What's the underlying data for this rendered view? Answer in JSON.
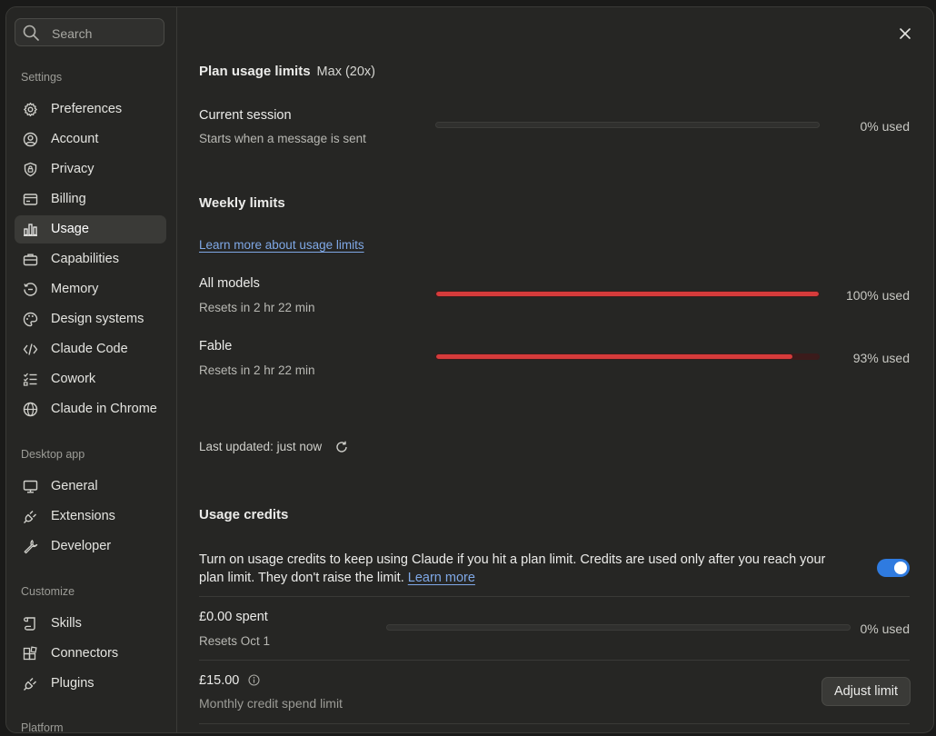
{
  "search": {
    "placeholder": "Search"
  },
  "sidebar": {
    "groups": [
      {
        "label": "Settings"
      },
      {
        "label": "Desktop app"
      },
      {
        "label": "Customize"
      },
      {
        "label": "Platform"
      }
    ],
    "items": [
      {
        "label": "Preferences",
        "icon": "gear-icon"
      },
      {
        "label": "Account",
        "icon": "user-circle-icon"
      },
      {
        "label": "Privacy",
        "icon": "shield-lock-icon"
      },
      {
        "label": "Billing",
        "icon": "credit-card-icon"
      },
      {
        "label": "Usage",
        "icon": "bar-chart-icon",
        "active": true
      },
      {
        "label": "Capabilities",
        "icon": "briefcase-icon"
      },
      {
        "label": "Memory",
        "icon": "history-icon"
      },
      {
        "label": "Design systems",
        "icon": "palette-icon"
      },
      {
        "label": "Claude Code",
        "icon": "code-icon"
      },
      {
        "label": "Cowork",
        "icon": "checklist-icon"
      },
      {
        "label": "Claude in Chrome",
        "icon": "globe-icon"
      },
      {
        "label": "General",
        "icon": "monitor-icon"
      },
      {
        "label": "Extensions",
        "icon": "plug-icon"
      },
      {
        "label": "Developer",
        "icon": "wrench-icon"
      },
      {
        "label": "Skills",
        "icon": "scroll-icon"
      },
      {
        "label": "Connectors",
        "icon": "blocks-icon"
      },
      {
        "label": "Plugins",
        "icon": "plug-icon"
      }
    ]
  },
  "plan": {
    "title": "Plan usage limits",
    "tier": "Max (20x)",
    "session": {
      "title": "Current session",
      "sub": "Starts when a message is sent",
      "pct_label": "0% used",
      "fraction": 0
    }
  },
  "weekly": {
    "title": "Weekly limits",
    "learn_link": "Learn more about usage limits",
    "rows": [
      {
        "title": "All models",
        "sub": "Resets in 2 hr 22 min",
        "pct_label": "100% used",
        "fraction": 1.0
      },
      {
        "title": "Fable",
        "sub": "Resets in 2 hr 22 min",
        "pct_label": "93% used",
        "fraction": 0.93
      }
    ],
    "last_updated": "Last updated: just now"
  },
  "credits": {
    "title": "Usage credits",
    "description": "Turn on usage credits to keep using Claude if you hit a plan limit. Credits are used only after you reach your plan limit. They don't raise the limit.",
    "learn_more": "Learn more",
    "toggle_on": true,
    "spent": {
      "title": "£0.00 spent",
      "sub": "Resets Oct 1",
      "pct_label": "0% used",
      "fraction": 0
    },
    "limit": {
      "title": "£15.00",
      "sub": "Monthly credit spend limit",
      "button": "Adjust limit"
    }
  },
  "colors": {
    "accent": "#2f7be0",
    "danger": "#d63b3b",
    "link": "#7fa8e6"
  }
}
